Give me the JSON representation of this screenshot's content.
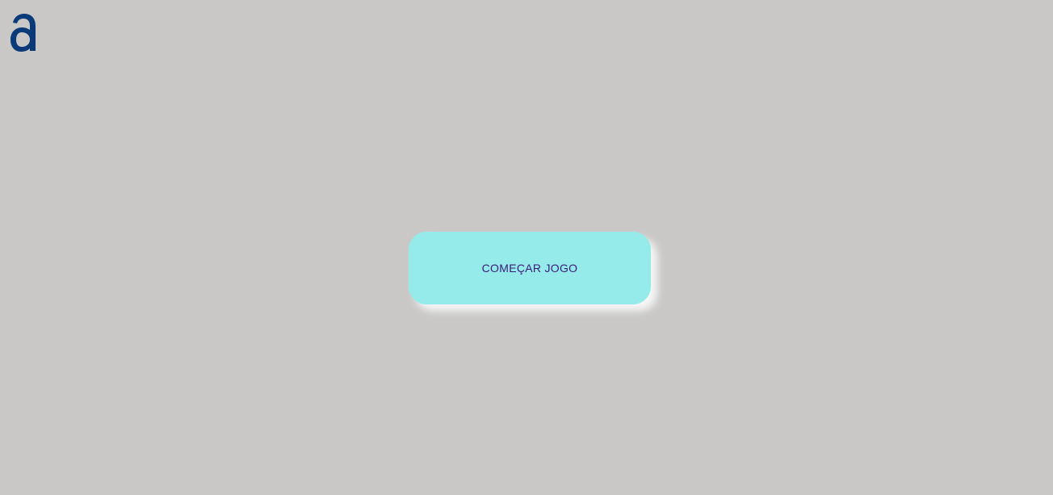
{
  "logo": {
    "icon": "brand-a-logo",
    "color": "#0b3a78"
  },
  "start_button": {
    "label": "COMEÇAR JOGO",
    "background": "#94ebea",
    "text_color": "#3b1a7a"
  },
  "page": {
    "background": "#c9c8c7"
  }
}
